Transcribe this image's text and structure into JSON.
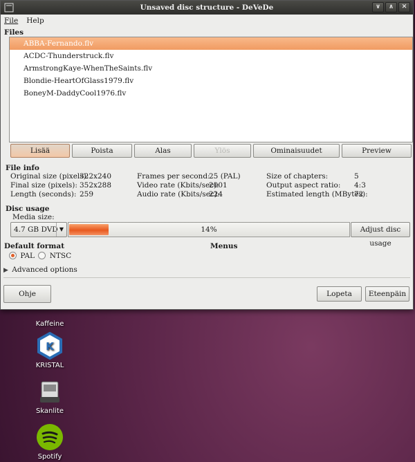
{
  "window": {
    "title": "Unsaved disc structure - DeVeDe"
  },
  "window_buttons": [
    "∨",
    "∧",
    "✕"
  ],
  "menu": [
    {
      "label": "File"
    },
    {
      "label": "Help"
    }
  ],
  "files": {
    "heading": "Files",
    "items": [
      "ABBA-Fernando.flv",
      "ACDC-Thunderstruck.flv",
      "ArmstrongKaye-WhenTheSaints.flv",
      "Blondie-HeartOfGlass1979.flv",
      "BoneyM-DaddyCool1976.flv"
    ],
    "selected_index": 0
  },
  "file_buttons": {
    "add": "Lisää",
    "remove": "Poista",
    "down": "Alas",
    "up": "Ylös",
    "properties": "Ominaisuudet",
    "preview": "Preview"
  },
  "file_info": {
    "heading": "File info",
    "original_size_label": "Original size (pixels):",
    "original_size": "322x240",
    "final_size_label": "Final size (pixels):",
    "final_size": "352x288",
    "length_label": "Length (seconds):",
    "length": "259",
    "fps_label": "Frames per second:",
    "fps": "25 (PAL)",
    "video_rate_label": "Video rate (Kbits/sec):",
    "video_rate": "2001",
    "audio_rate_label": "Audio rate (Kbits/sec):",
    "audio_rate": "224",
    "chapters_label": "Size of chapters:",
    "chapters": "5",
    "aspect_label": "Output aspect ratio:",
    "aspect": "4:3",
    "est_length_label": "Estimated length (MBytes):",
    "est_length": "72"
  },
  "disc_usage": {
    "heading": "Disc usage",
    "media_size_label": "Media size:",
    "media_size": "4.7 GB DVD",
    "percent_text": "14%",
    "percent": 14,
    "adjust_button": "Adjust disc usage"
  },
  "default_format": {
    "heading": "Default format",
    "pal": "PAL",
    "ntsc": "NTSC",
    "selected": "PAL"
  },
  "menus_heading": "Menus",
  "advanced": {
    "label": "Advanced options"
  },
  "bottom_buttons": {
    "help": "Ohje",
    "quit": "Lopeta",
    "next": "Eteenpäin"
  },
  "desktop_icons": [
    {
      "label": "Kaffeine",
      "icon": "kaffeine-icon"
    },
    {
      "label": "KRISTAL",
      "icon": "kristal-icon"
    },
    {
      "label": "Skanlite",
      "icon": "scanner-icon"
    },
    {
      "label": "Spotify",
      "icon": "spotify-icon"
    }
  ],
  "colors": {
    "accent": "#f09b62",
    "titlebar": "#3a3a36",
    "desktop": "#5a2548"
  }
}
